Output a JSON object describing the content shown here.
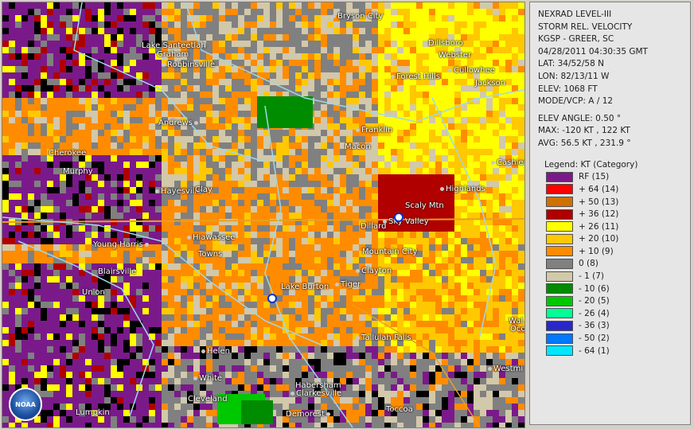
{
  "info": {
    "product": "NEXRAD LEVEL-III",
    "type": "STORM REL. VELOCITY",
    "site": "KGSP - GREER, SC",
    "datetime": "04/28/2011 04:30:35 GMT",
    "lat": "LAT: 34/52/58 N",
    "lon": "LON: 82/13/11 W",
    "elev": "ELEV: 1068 FT",
    "mode": "MODE/VCP: A / 12",
    "elev_angle": "ELEV ANGLE: 0.50 °",
    "max": "MAX: -120 KT , 122 KT",
    "avg": "AVG: 56.5 KT , 231.9 °"
  },
  "legend": {
    "title": "Legend: KT (Category)",
    "items": [
      {
        "label": "RF (15)",
        "color": "#7a1a8a"
      },
      {
        "label": "+ 64 (14)",
        "color": "#ff0000"
      },
      {
        "label": "+ 50 (13)",
        "color": "#d07000"
      },
      {
        "label": "+ 36 (12)",
        "color": "#b00000"
      },
      {
        "label": "+ 26 (11)",
        "color": "#ffff00"
      },
      {
        "label": "+ 20 (10)",
        "color": "#ffc800"
      },
      {
        "label": "+ 10 (9)",
        "color": "#ff8c00"
      },
      {
        "label": "0 (8)",
        "color": "#808080"
      },
      {
        "label": "- 1 (7)",
        "color": "#d2c8aa"
      },
      {
        "label": "- 10 (6)",
        "color": "#008c00"
      },
      {
        "label": "- 20 (5)",
        "color": "#00c800"
      },
      {
        "label": "- 26 (4)",
        "color": "#00ff96"
      },
      {
        "label": "- 36 (3)",
        "color": "#2828c8"
      },
      {
        "label": "- 50 (2)",
        "color": "#0078ff"
      },
      {
        "label": "- 64 (1)",
        "color": "#00e6ff"
      }
    ]
  },
  "places": [
    "Bryson City",
    "Dillsboro",
    "Webster",
    "Lake Santeetlah",
    "Graham",
    "Robbinsville",
    "Cullowhee",
    "Forest Hills",
    "Jackson",
    "Andrews",
    "Franklin",
    "Macon",
    "Cherokee",
    "Cashiers",
    "Murphy",
    "Hayesville",
    "Clay",
    "Highlands",
    "Scaly Mtn",
    "Dillard",
    "Sky Valley",
    "Hiawassee",
    "Young Harris",
    "Towns",
    "Mountain City",
    "Clayton",
    "Blairsville",
    "Union",
    "Lake Burton",
    "Tiger",
    "Tallulah Falls",
    "Helen",
    "White",
    "Habersham",
    "Clarkesville",
    "Cleveland",
    "Demorest",
    "Toccoa",
    "Westmi",
    "Lumpkin",
    "Wal",
    "Oco"
  ],
  "logo_text": "NOAA"
}
